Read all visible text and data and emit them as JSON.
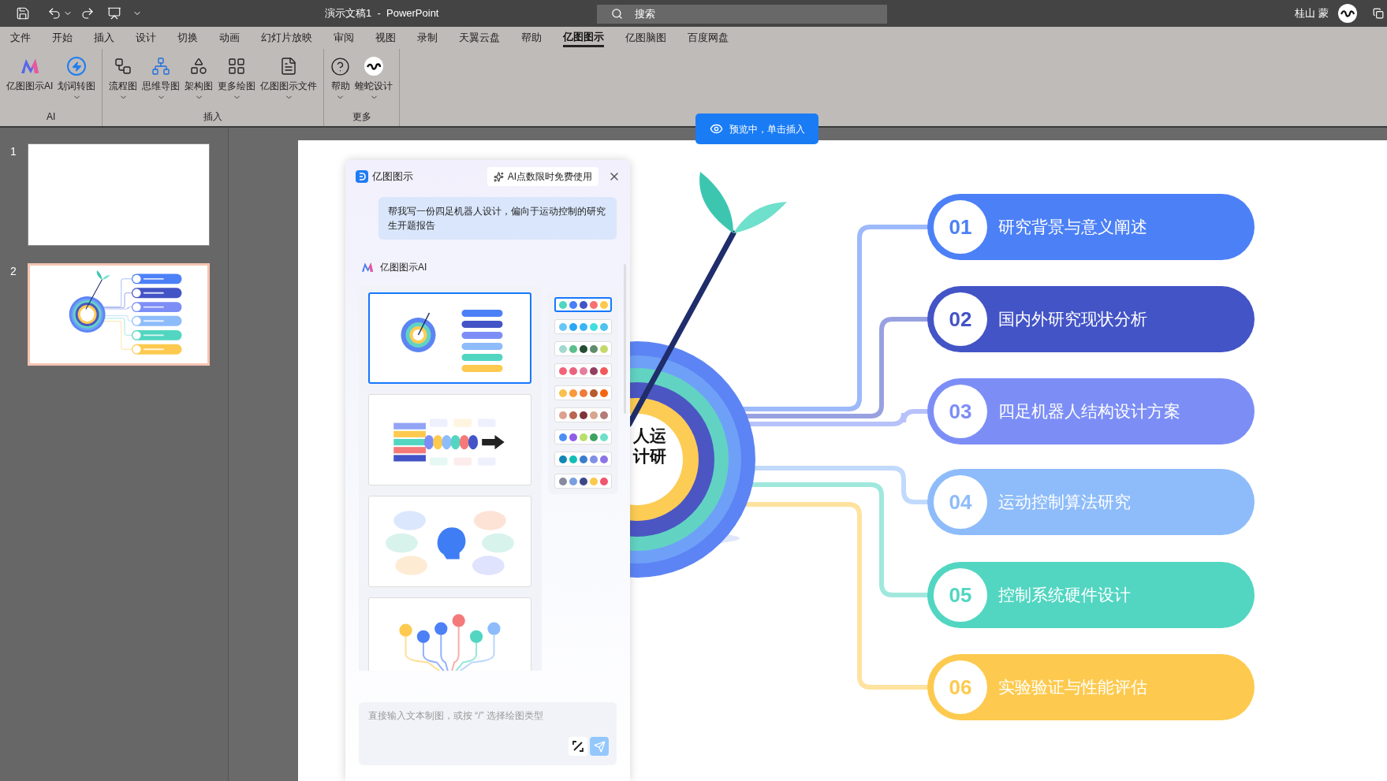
{
  "title_bar": {
    "document_title": "演示文稿1  -  PowerPoint",
    "search": {
      "placeholder": "搜索"
    },
    "user_name": "桂山 蒙"
  },
  "menu_tabs": [
    {
      "label": "文件",
      "selected": false
    },
    {
      "label": "开始",
      "selected": false
    },
    {
      "label": "插入",
      "selected": false
    },
    {
      "label": "设计",
      "selected": false
    },
    {
      "label": "切换",
      "selected": false
    },
    {
      "label": "动画",
      "selected": false
    },
    {
      "label": "幻灯片放映",
      "selected": false
    },
    {
      "label": "审阅",
      "selected": false
    },
    {
      "label": "视图",
      "selected": false
    },
    {
      "label": "录制",
      "selected": false
    },
    {
      "label": "天翼云盘",
      "selected": false
    },
    {
      "label": "帮助",
      "selected": false
    },
    {
      "label": "亿图图示",
      "selected": true
    },
    {
      "label": "亿图脑图",
      "selected": false
    },
    {
      "label": "百度网盘",
      "selected": false
    }
  ],
  "ribbon_groups": [
    {
      "label": "AI",
      "buttons": [
        {
          "label": "亿图图示AI",
          "dropdown": false
        },
        {
          "label": "划词转图",
          "dropdown": true
        }
      ]
    },
    {
      "label": "插入",
      "buttons": [
        {
          "label": "流程图",
          "dropdown": true
        },
        {
          "label": "思维导图",
          "dropdown": true
        },
        {
          "label": "架构图",
          "dropdown": true
        },
        {
          "label": "更多绘图",
          "dropdown": true
        },
        {
          "label": "亿图图示文件",
          "dropdown": true
        }
      ]
    },
    {
      "label": "更多",
      "buttons": [
        {
          "label": "帮助",
          "dropdown": true
        },
        {
          "label": "蝰蛇设计",
          "dropdown": true
        }
      ]
    }
  ],
  "slides_panel": [
    {
      "number": "1",
      "selected": false
    },
    {
      "number": "2",
      "selected": true
    }
  ],
  "preview_button": "预览中，单击插入",
  "slide": {
    "center_title_lines": [
      "人运",
      "计研"
    ],
    "topics": [
      {
        "number": "01",
        "label": "研究背景与意义阐述",
        "color": "#4c80f6"
      },
      {
        "number": "02",
        "label": "国内外研究现状分析",
        "color": "#4354c6"
      },
      {
        "number": "03",
        "label": "四足机器人结构设计方案",
        "color": "#7c8ef6"
      },
      {
        "number": "04",
        "label": "运动控制算法研究",
        "color": "#8ebcfa"
      },
      {
        "number": "05",
        "label": "控制系统硬件设计",
        "color": "#52d6c1"
      },
      {
        "number": "06",
        "label": "实验验证与性能评估",
        "color": "#fdca4f"
      }
    ]
  },
  "panel": {
    "title": "亿图图示",
    "promo_button": "AI点数限时免费使用",
    "prompt": "帮我写一份四足机器人设计，偏向于运动控制的研究生开题报告",
    "assistant_name": "亿图图示AI",
    "templates": [
      {
        "selected": true
      },
      {
        "selected": false
      },
      {
        "selected": false
      },
      {
        "selected": false
      }
    ],
    "palettes": [
      {
        "swatches": [
          {
            "color": "#4fd6c0"
          },
          {
            "color": "#4a7ef5"
          },
          {
            "color": "#4255c6"
          },
          {
            "color": "#f87171"
          },
          {
            "color": "#fcc94c"
          }
        ],
        "selected": true
      },
      {
        "swatches": [
          {
            "color": "#67c6f8"
          },
          {
            "color": "#2aa7f5"
          },
          {
            "color": "#3bb4f7"
          },
          {
            "color": "#3de0dd"
          },
          {
            "color": "#4dc3ef"
          }
        ],
        "selected": false
      },
      {
        "swatches": [
          {
            "color": "#a3d8cf"
          },
          {
            "color": "#5abf8c"
          },
          {
            "color": "#234d33"
          },
          {
            "color": "#5f8d6b"
          },
          {
            "color": "#c2d96a"
          }
        ],
        "selected": false
      },
      {
        "swatches": [
          {
            "color": "#f2637a"
          },
          {
            "color": "#e9637f"
          },
          {
            "color": "#e57e9e"
          },
          {
            "color": "#923f62"
          },
          {
            "color": "#f05a5a"
          }
        ],
        "selected": false
      },
      {
        "swatches": [
          {
            "color": "#f9c04c"
          },
          {
            "color": "#f99a3a"
          },
          {
            "color": "#f07a3a"
          },
          {
            "color": "#b75a2d"
          },
          {
            "color": "#f4650f"
          }
        ],
        "selected": false
      },
      {
        "swatches": [
          {
            "color": "#dca18e"
          },
          {
            "color": "#b96554"
          },
          {
            "color": "#7e3438"
          },
          {
            "color": "#d6a78c"
          },
          {
            "color": "#b37d78"
          }
        ],
        "selected": false
      },
      {
        "swatches": [
          {
            "color": "#4d8df5"
          },
          {
            "color": "#8e5ee8"
          },
          {
            "color": "#b8e06a"
          },
          {
            "color": "#3ea25f"
          },
          {
            "color": "#6de0c8"
          }
        ],
        "selected": false
      },
      {
        "swatches": [
          {
            "color": "#1187b6"
          },
          {
            "color": "#10bfb5"
          },
          {
            "color": "#3b7ccf"
          },
          {
            "color": "#7f90e6"
          },
          {
            "color": "#8d75e6"
          }
        ],
        "selected": false
      },
      {
        "swatches": [
          {
            "color": "#888aa0"
          },
          {
            "color": "#7a9fde"
          },
          {
            "color": "#3d4787"
          },
          {
            "color": "#fbc94b"
          },
          {
            "color": "#f0566f"
          }
        ],
        "selected": false
      }
    ],
    "input": {
      "placeholder": "直接输入文本制图，或按 “/” 选择绘图类型"
    }
  }
}
